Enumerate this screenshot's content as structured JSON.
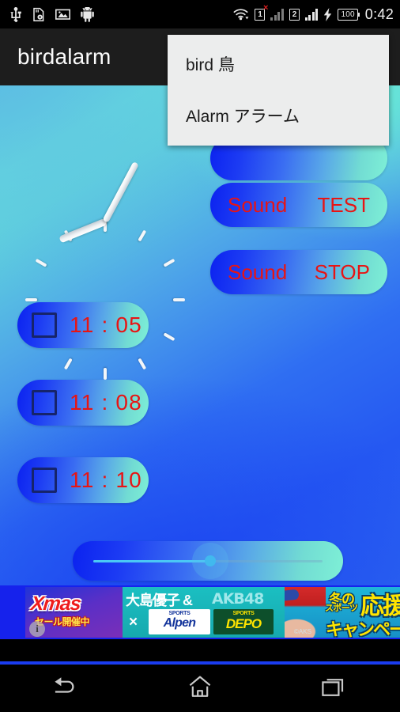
{
  "statusbar": {
    "icons": [
      "usb-icon",
      "sd-card-settings-icon",
      "image-icon",
      "android-robot-icon",
      "wifi-icon"
    ],
    "sim1_label": "1",
    "sim1_error": "×",
    "sim2_label": "2",
    "battery_level": "100",
    "clock": "0:42"
  },
  "actionbar": {
    "title": "birdalarm",
    "overflow_icon": "overflow-menu-icon"
  },
  "menu": {
    "items": [
      {
        "label": "bird 鳥"
      },
      {
        "label": "Alarm アラーム"
      }
    ]
  },
  "clock_widget": {
    "name": "analog-clock",
    "hour_angle": 248,
    "minute_angle": 28,
    "tick_count": 12
  },
  "sound_buttons": [
    {
      "left_label": "",
      "right_label": "",
      "name": "sound-button-hidden"
    },
    {
      "left_label": "Sound",
      "right_label": "TEST",
      "name": "sound-test-button"
    },
    {
      "left_label": "Sound",
      "right_label": "STOP",
      "name": "sound-stop-button"
    }
  ],
  "alarms": [
    {
      "time": "11 : 05",
      "checked": false
    },
    {
      "time": "11 : 08",
      "checked": false
    },
    {
      "time": "11 : 10",
      "checked": false
    }
  ],
  "slider": {
    "name": "volume-slider",
    "value_percent": 51
  },
  "ad": {
    "xmas_title": "Xmas",
    "xmas_sub": "セール開催中",
    "info_glyph": "i",
    "talent": "大島優子 &",
    "group": "AKB48",
    "cross": "×",
    "alpen_small": "SPORTS",
    "alpen_name": "Alpen",
    "depo_small": "SPORTS",
    "depo_name": "DEPO",
    "headline_1": "冬の",
    "headline_2": "スポーツ",
    "headline_big": "応援",
    "headline_3": "キャンペーン",
    "copyright": "©AKS"
  },
  "navbar": {
    "back_label": "back-icon",
    "home_label": "home-icon",
    "recents_label": "recents-icon"
  },
  "colors": {
    "accent_red": "#e81414",
    "bg_cyan": "#62d9dd",
    "bg_blue": "#2558f2",
    "menu_bg": "#eceded",
    "actionbar_bg": "#1d1d1d",
    "checkbox_border": "#16246b"
  }
}
